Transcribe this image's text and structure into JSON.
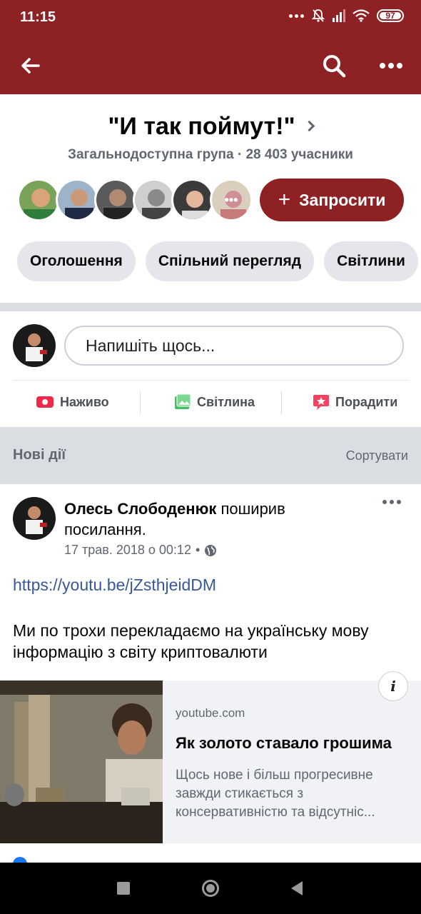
{
  "status_bar": {
    "time": "11:15",
    "battery": "97"
  },
  "app_bar": {
    "back_icon": "arrow-left-icon",
    "search_icon": "search-icon",
    "more_icon": "more-horizontal-icon"
  },
  "group": {
    "title": "\"И так поймут!\"",
    "subtitle": "Загальнодоступна група · 28 403 учасники",
    "invite_label": "Запросити",
    "members_more": "•••"
  },
  "tabs": [
    {
      "label": "Оголошення"
    },
    {
      "label": "Спільний перегляд"
    },
    {
      "label": "Світлини"
    }
  ],
  "composer": {
    "placeholder": "Напишіть щось...",
    "actions": [
      {
        "label": "Наживо",
        "icon": "live-video-icon",
        "color": "#f02849"
      },
      {
        "label": "Світлина",
        "icon": "photo-icon",
        "color": "#45bd62"
      },
      {
        "label": "Порадити",
        "icon": "recommend-icon",
        "color": "#f3425f"
      }
    ]
  },
  "feed_header": {
    "label": "Нові дії",
    "sort_label": "Сортувати"
  },
  "post": {
    "author": "Олесь Слободенюк",
    "action_text": " поширив посилання.",
    "timestamp": "17 трав. 2018 о 00:12",
    "separator": "•",
    "link": "https://youtu.be/jZsthjeidDM",
    "text": "Ми по трохи перекладаємо на українську мову інформацію з світу криптовалюти",
    "preview": {
      "domain": "youtube.com",
      "title": "Як золото ставало грошима",
      "description": "Щось нове і більш прогресивне завжди стикається з консервативністю та відсутніс..."
    }
  },
  "colors": {
    "brand": "#8e2124",
    "link": "#385898",
    "muted": "#606770"
  }
}
